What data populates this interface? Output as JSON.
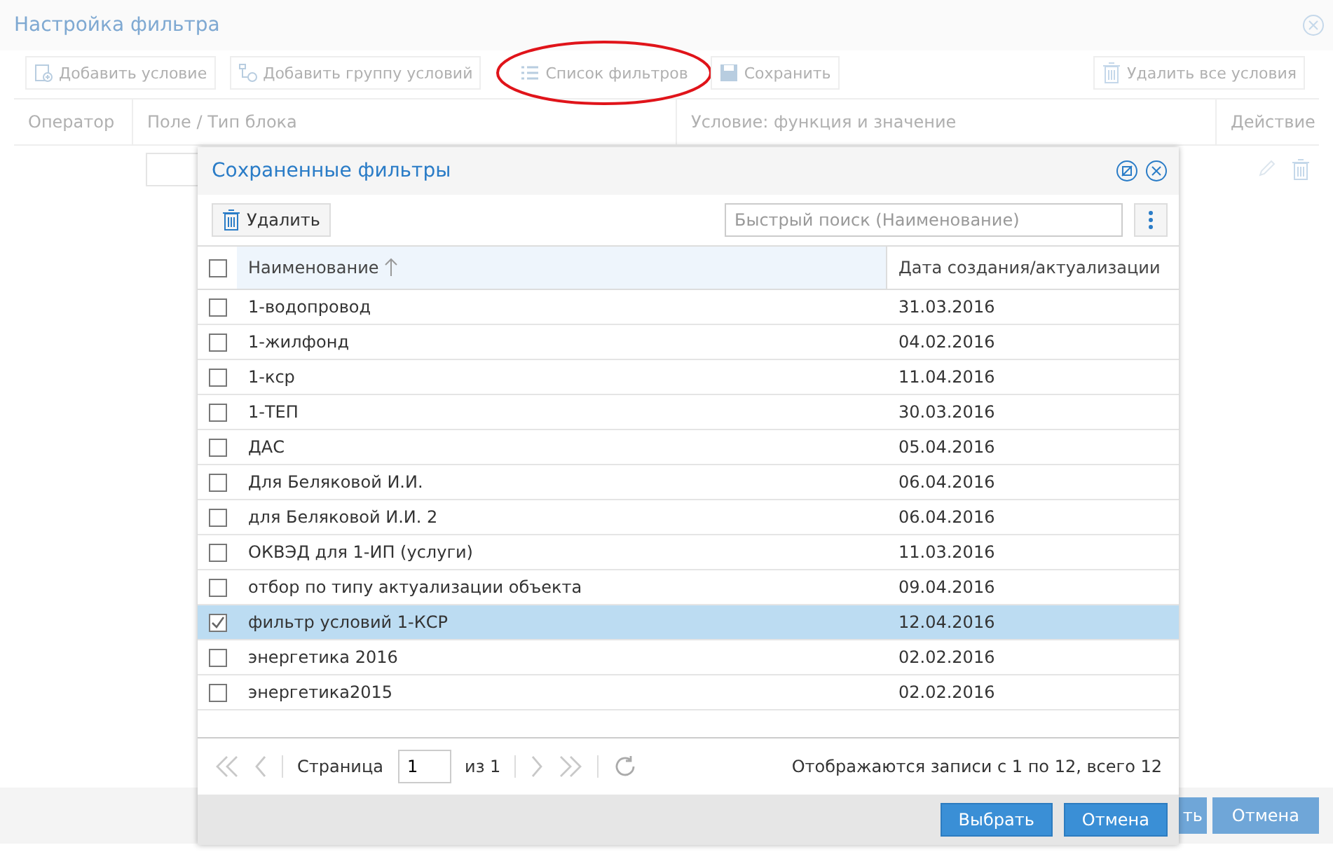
{
  "dialog": {
    "title": "Настройка фильтра",
    "toolbar": [
      {
        "label": "Добавить условие",
        "kind": "add"
      },
      {
        "label": "Добавить группу условий",
        "kind": "group"
      },
      {
        "label": "Список фильтров",
        "kind": "list",
        "highlighted": true
      },
      {
        "label": "Сохранить",
        "kind": "save"
      },
      {
        "label": "Удалить все условия",
        "kind": "delete"
      }
    ],
    "columns": [
      "Оператор",
      "Поле / Тип блока",
      "Условие: функция и значение",
      "Действие"
    ],
    "footer_buttons": [
      "ть",
      "Отмена"
    ]
  },
  "modal": {
    "title": "Сохраненные фильтры",
    "delete_button": "Удалить",
    "search": {
      "placeholder": "Быстрый поиск (Наименование)"
    },
    "columns": [
      "Наименование",
      "Дата создания/актуализации"
    ],
    "all_checked": false,
    "rows": [
      {
        "name": "1-водопровод",
        "date": "31.03.2016",
        "selected": false
      },
      {
        "name": "1-жилфонд",
        "date": "04.02.2016",
        "selected": false
      },
      {
        "name": "1-кср",
        "date": "11.04.2016",
        "selected": false
      },
      {
        "name": "1-ТЕП",
        "date": "30.03.2016",
        "selected": false
      },
      {
        "name": "ДАС",
        "date": "05.04.2016",
        "selected": false
      },
      {
        "name": "Для Беляковой И.И.",
        "date": "06.04.2016",
        "selected": false
      },
      {
        "name": "для Беляковой И.И. 2",
        "date": "06.04.2016",
        "selected": false
      },
      {
        "name": "ОКВЭД для 1-ИП (услуги)",
        "date": "11.03.2016",
        "selected": false
      },
      {
        "name": "отбор по типу актуализации объекта",
        "date": "09.04.2016",
        "selected": false
      },
      {
        "name": "фильтр условий 1-КСР",
        "date": "12.04.2016",
        "selected": true
      },
      {
        "name": "энергетика 2016",
        "date": "02.02.2016",
        "selected": false
      },
      {
        "name": "энергетика2015",
        "date": "02.02.2016",
        "selected": false
      }
    ],
    "pager": {
      "page_label": "Страница",
      "page": "1",
      "of_label": "из 1",
      "summary": "Отображаются записи с 1 по 12, всего 12"
    },
    "buttons": [
      "Выбрать",
      "Отмена"
    ]
  }
}
